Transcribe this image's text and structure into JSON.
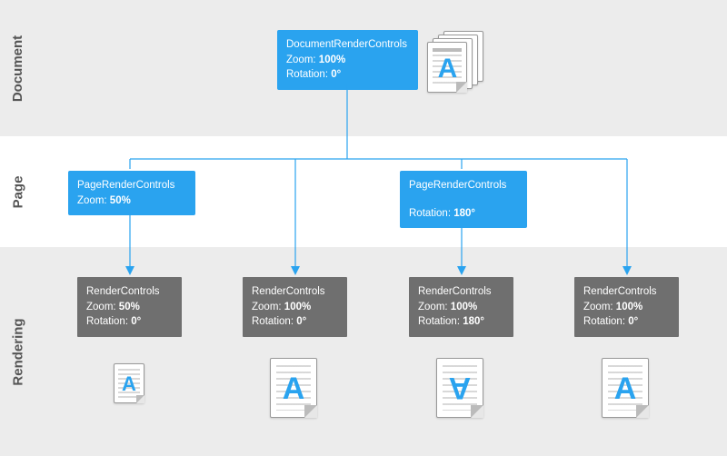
{
  "labels": {
    "document": "Document",
    "page": "Page",
    "rendering": "Rendering"
  },
  "doc_node": {
    "title": "DocumentRenderControls",
    "zoom_label": "Zoom:",
    "zoom_value": "100%",
    "rot_label": "Rotation:",
    "rot_value": "0°"
  },
  "page_nodes": [
    {
      "title": "PageRenderControls",
      "zoom_label": "Zoom:",
      "zoom_value": "50%",
      "rot_label": "",
      "rot_value": ""
    },
    {
      "title": "PageRenderControls",
      "zoom_label": "",
      "zoom_value": "",
      "rot_label": "Rotation:",
      "rot_value": "180°"
    }
  ],
  "render_nodes": [
    {
      "title": "RenderControls",
      "zoom_label": "Zoom:",
      "zoom_value": "50%",
      "rot_label": "Rotation:",
      "rot_value": "0°"
    },
    {
      "title": "RenderControls",
      "zoom_label": "Zoom:",
      "zoom_value": "100%",
      "rot_label": "Rotation:",
      "rot_value": "0°"
    },
    {
      "title": "RenderControls",
      "zoom_label": "Zoom:",
      "zoom_value": "100%",
      "rot_label": "Rotation:",
      "rot_value": "180°"
    },
    {
      "title": "RenderControls",
      "zoom_label": "Zoom:",
      "zoom_value": "100%",
      "rot_label": "Rotation:",
      "rot_value": "0°"
    }
  ]
}
